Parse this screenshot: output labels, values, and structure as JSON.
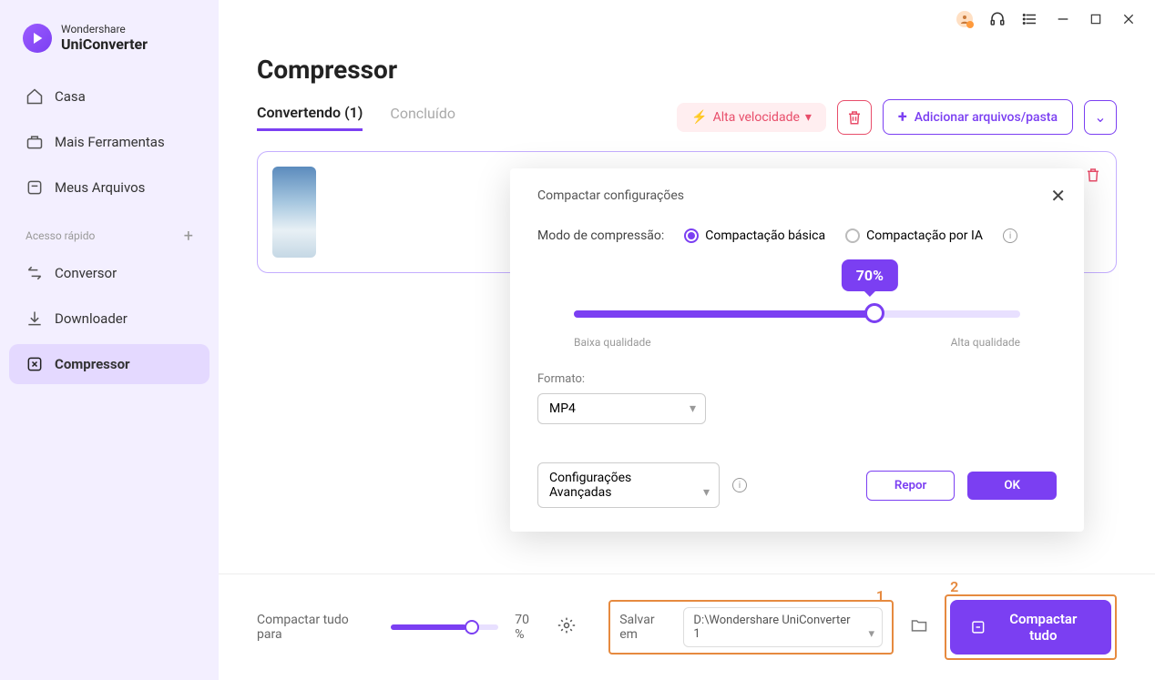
{
  "app": {
    "brand_top": "Wondershare",
    "brand_name": "UniConverter"
  },
  "sidebar": {
    "items": [
      {
        "label": "Casa"
      },
      {
        "label": "Mais Ferramentas"
      },
      {
        "label": "Meus Arquivos"
      }
    ],
    "quick_label": "Acesso rápido",
    "quick_items": [
      {
        "label": "Conversor"
      },
      {
        "label": "Downloader"
      },
      {
        "label": "Compressor"
      }
    ]
  },
  "page": {
    "title": "Compressor"
  },
  "tabs": {
    "converting": "Convertendo (1)",
    "done": "Concluído"
  },
  "actions": {
    "high_speed": "Alta velocidade",
    "add_files": "Adicionar arquivos/pasta"
  },
  "bottom": {
    "compress_all_for": "Compactar tudo para",
    "percent": "70",
    "percent_sym": "%",
    "save_in": "Salvar em",
    "save_path": "D:\\Wondershare UniConverter 1",
    "compress_all": "Compactar tudo"
  },
  "modal": {
    "title": "Compactar configurações",
    "mode_label": "Modo de compressão:",
    "mode_basic": "Compactação básica",
    "mode_ai": "Compactação por IA",
    "slider_val": "70%",
    "low": "Baixa qualidade",
    "high": "Alta qualidade",
    "format_label": "Formato:",
    "format_value": "MP4",
    "advanced": "Configurações Avançadas",
    "reset": "Repor",
    "ok": "OK"
  }
}
